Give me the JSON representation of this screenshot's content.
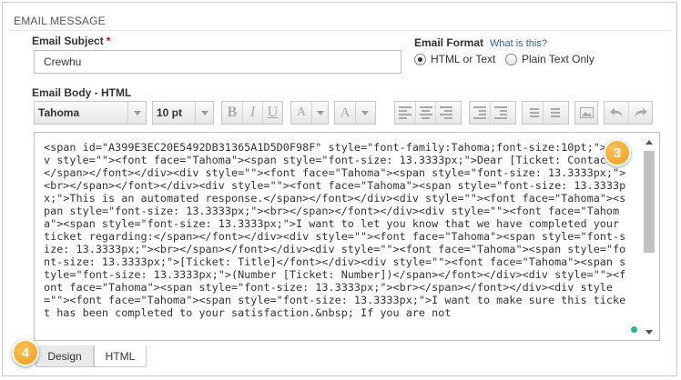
{
  "section": {
    "title": "EMAIL MESSAGE"
  },
  "subject": {
    "label": "Email Subject",
    "required_mark": "*",
    "value": "Crewhu"
  },
  "format": {
    "label": "Email Format",
    "help_link": "What is this?",
    "options": [
      {
        "label": "HTML or Text",
        "selected": true
      },
      {
        "label": "Plain Text Only",
        "selected": false
      }
    ]
  },
  "body": {
    "label": "Email Body - HTML",
    "font_family": "Tahoma",
    "font_size": "10 pt",
    "toolbar_icons": [
      "bold-icon",
      "italic-icon",
      "underline-icon",
      "font-size-icon",
      "font-color-icon",
      "align-left-icon",
      "align-center-icon",
      "align-right-icon",
      "outdent-icon",
      "indent-icon",
      "numbered-list-icon",
      "bullet-list-icon",
      "image-icon",
      "undo-icon",
      "redo-icon"
    ],
    "toolbar_glyphs": {
      "bold": "B",
      "italic": "I",
      "underline": "U",
      "font_size": "A",
      "font_color": "A"
    },
    "code": "<span id=\"A399E3EC20E5492DB31365A1D5D0F98F\" style=\"font-family:Tahoma;font-size:10pt;\"><div style=\"\"><font face=\"Tahoma\"><span style=\"font-size: 13.3333px;\">Dear [Ticket: Contact],</span></font></div><div style=\"\"><font face=\"Tahoma\"><span style=\"font-size: 13.3333px;\"><br></span></font></div><div style=\"\"><font face=\"Tahoma\"><span style=\"font-size: 13.3333px;\">This is an automated response.</span></font></div><div style=\"\"><font face=\"Tahoma\"><span style=\"font-size: 13.3333px;\"><br></span></font></div><div style=\"\"><font face=\"Tahoma\"><span style=\"font-size: 13.3333px;\">I want to let you know that we have completed your ticket regarding:</span></font></div><div style=\"\"><font face=\"Tahoma\"><span style=\"font-size: 13.3333px;\"><br></span></font></div><div style=\"\"><font face=\"Tahoma\"><span style=\"font-size: 13.3333px;\">[Ticket: Title]</font></div><div style=\"\"><font face=\"Tahoma\"><span style=\"font-size: 13.3333px;\">(Number [Ticket: Number])</span></font></div><div style=\"\"><font face=\"Tahoma\"><span style=\"font-size: 13.3333px;\"><br></span></font></div><div style=\"\"><font face=\"Tahoma\"><span style=\"font-size: 13.3333px;\">I want to make sure this ticket has been completed to your satisfaction.&nbsp; If you are not"
  },
  "callouts": {
    "editor": "3",
    "tabs": "4"
  },
  "tabs": [
    {
      "label": "Design",
      "active": false
    },
    {
      "label": "HTML",
      "active": true
    }
  ],
  "colors": {
    "accent_badge": "#f09a12",
    "link": "#2a5db0",
    "required": "#d0021b",
    "status_dot": "#2ab58a"
  }
}
